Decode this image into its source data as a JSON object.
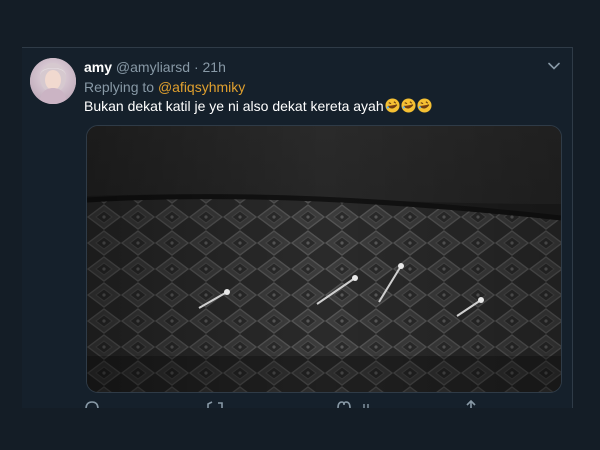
{
  "tweet": {
    "display_name": "amy",
    "handle": "@amyliarsd",
    "separator": "·",
    "time": "21h",
    "replying_prefix": "Replying to",
    "replying_handle": "@afiqsyhmiky",
    "text": "Bukan dekat katil je ye ni also dekat kereta ayah",
    "emoji": [
      "rolling-on-floor-laughing-icon",
      "rolling-on-floor-laughing-icon",
      "rolling-on-floor-laughing-icon"
    ]
  },
  "actions": {
    "reply_icon": "reply-icon",
    "retweet_icon": "retweet-icon",
    "like_icon": "heart-icon",
    "share_icon": "share-icon"
  },
  "colors": {
    "background": "#141d26",
    "card": "#15202b",
    "text_primary": "#ffffff",
    "text_secondary": "#8899a6",
    "mention": "#e0a02e"
  }
}
